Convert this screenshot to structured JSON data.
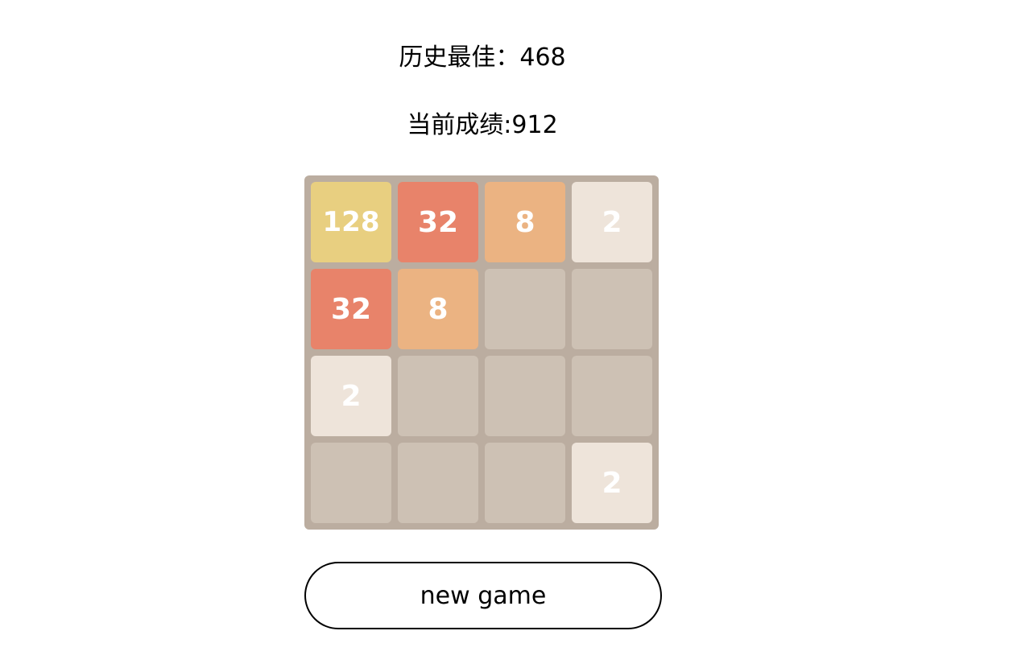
{
  "scores": {
    "best_label": "历史最佳：",
    "best_value": "468",
    "current_label": "当前成绩:",
    "current_value": "912"
  },
  "board": {
    "rows": [
      [
        "128",
        "32",
        "8",
        "2"
      ],
      [
        "32",
        "8",
        "",
        ""
      ],
      [
        "2",
        "",
        "",
        ""
      ],
      [
        "",
        "",
        "",
        "2"
      ]
    ]
  },
  "colors": {
    "board_bg": "#bbada0",
    "empty": "#cdc1b4",
    "tile_2": "#eee4da",
    "tile_8": "#ebb382",
    "tile_32": "#e8836a",
    "tile_128": "#e8cf80"
  },
  "button": {
    "label": "new game"
  }
}
